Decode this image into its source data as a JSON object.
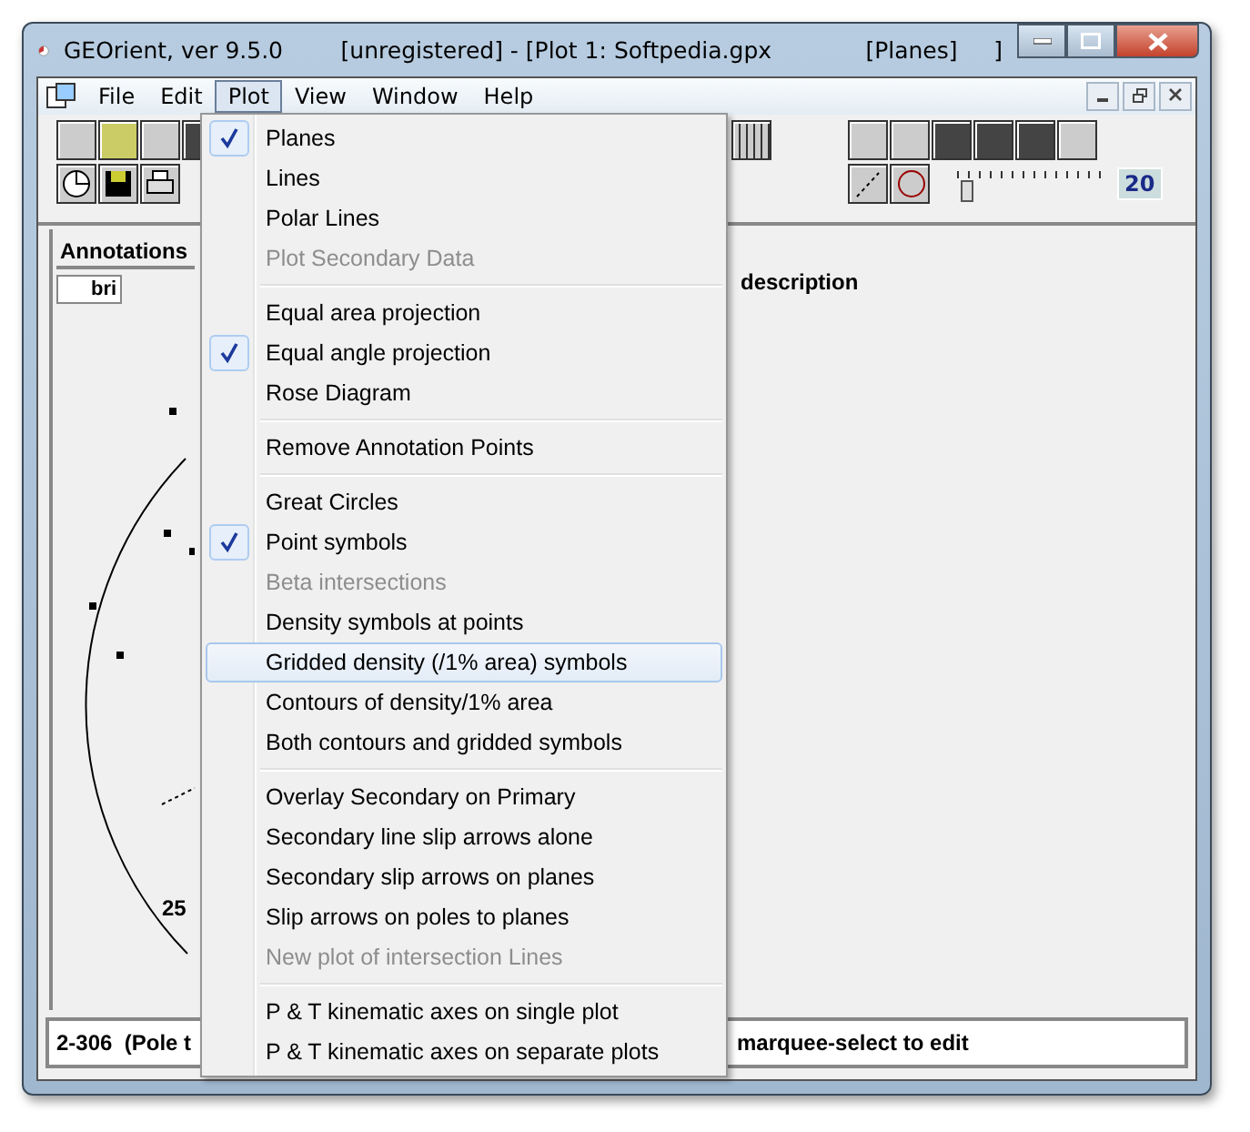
{
  "window": {
    "title": "GEOrient, ver 9.5.0        [unregistered] - [Plot 1: Softpedia.gpx             [Planes]     ]"
  },
  "menu_bar": [
    {
      "label": "File",
      "selected": false
    },
    {
      "label": "Edit",
      "selected": false
    },
    {
      "label": "Plot",
      "selected": true
    },
    {
      "label": "View",
      "selected": false
    },
    {
      "label": "Window",
      "selected": false
    },
    {
      "label": "Help",
      "selected": false
    }
  ],
  "toolbar": {
    "slider": {
      "level": 0.02
    },
    "slider_value": "20"
  },
  "annotations": {
    "tab": "Annotations",
    "button": "bri",
    "description": "description"
  },
  "plot": {
    "axis_label": "25"
  },
  "status_bar": {
    "left": "2-306  (Pole t",
    "right": "marquee-select to edit"
  },
  "plot_menu": [
    {
      "kind": "item",
      "label": "Planes",
      "checked": true,
      "disabled": false,
      "selected": false
    },
    {
      "kind": "item",
      "label": "Lines",
      "checked": false,
      "disabled": false,
      "selected": false
    },
    {
      "kind": "item",
      "label": "Polar Lines",
      "checked": false,
      "disabled": false,
      "selected": false
    },
    {
      "kind": "item",
      "label": "Plot Secondary Data",
      "checked": false,
      "disabled": true,
      "selected": false
    },
    {
      "kind": "separator"
    },
    {
      "kind": "item",
      "label": "Equal area  projection",
      "checked": false,
      "disabled": false,
      "selected": false
    },
    {
      "kind": "item",
      "label": "Equal angle projection",
      "checked": true,
      "disabled": false,
      "selected": false
    },
    {
      "kind": "item",
      "label": "Rose Diagram",
      "checked": false,
      "disabled": false,
      "selected": false
    },
    {
      "kind": "separator"
    },
    {
      "kind": "item",
      "label": "Remove Annotation Points",
      "checked": false,
      "disabled": false,
      "selected": false
    },
    {
      "kind": "separator"
    },
    {
      "kind": "item",
      "label": "Great Circles",
      "checked": false,
      "disabled": false,
      "selected": false
    },
    {
      "kind": "item",
      "label": "Point symbols",
      "checked": true,
      "disabled": false,
      "selected": false
    },
    {
      "kind": "item",
      "label": "Beta intersections",
      "checked": false,
      "disabled": true,
      "selected": false
    },
    {
      "kind": "item",
      "label": "Density symbols at points",
      "checked": false,
      "disabled": false,
      "selected": false
    },
    {
      "kind": "item",
      "label": "Gridded density (/1% area) symbols",
      "checked": false,
      "disabled": false,
      "selected": true
    },
    {
      "kind": "item",
      "label": "Contours of density/1% area",
      "checked": false,
      "disabled": false,
      "selected": false
    },
    {
      "kind": "item",
      "label": "Both contours and gridded symbols",
      "checked": false,
      "disabled": false,
      "selected": false
    },
    {
      "kind": "separator"
    },
    {
      "kind": "item",
      "label": "Overlay Secondary on Primary",
      "checked": false,
      "disabled": false,
      "selected": false
    },
    {
      "kind": "item",
      "label": "Secondary line slip arrows alone",
      "checked": false,
      "disabled": false,
      "selected": false
    },
    {
      "kind": "item",
      "label": "Secondary slip arrows on planes",
      "checked": false,
      "disabled": false,
      "selected": false
    },
    {
      "kind": "item",
      "label": "Slip arrows on poles to planes",
      "checked": false,
      "disabled": false,
      "selected": false
    },
    {
      "kind": "item",
      "label": "New plot of intersection Lines",
      "checked": false,
      "disabled": true,
      "selected": false
    },
    {
      "kind": "separator"
    },
    {
      "kind": "item",
      "label": "P & T kinematic axes on single plot",
      "checked": false,
      "disabled": false,
      "selected": false
    },
    {
      "kind": "item",
      "label": "P & T kinematic axes on separate plots",
      "checked": false,
      "disabled": false,
      "selected": false
    }
  ]
}
